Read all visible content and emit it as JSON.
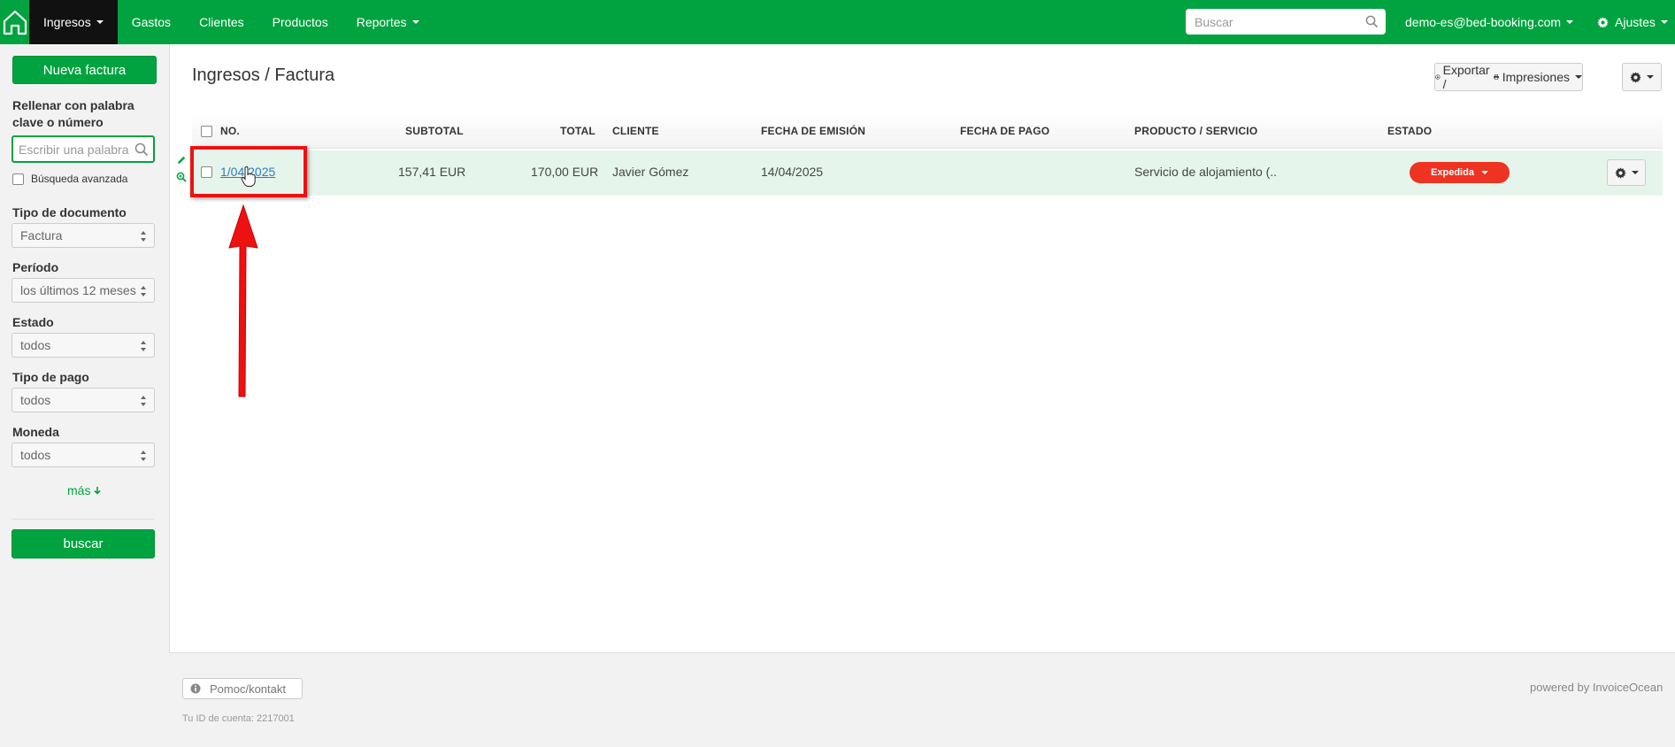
{
  "nav": {
    "items": [
      {
        "label": "Ingresos",
        "active": true,
        "dropdown": true
      },
      {
        "label": "Gastos",
        "active": false,
        "dropdown": false
      },
      {
        "label": "Clientes",
        "active": false,
        "dropdown": false
      },
      {
        "label": "Productos",
        "active": false,
        "dropdown": false
      },
      {
        "label": "Reportes",
        "active": false,
        "dropdown": true
      }
    ],
    "search_placeholder": "Buscar",
    "user": "demo-es@bed-booking.com",
    "settings": "Ajustes",
    "brand_color": "#00a33f"
  },
  "sidebar": {
    "new_invoice": "Nueva factura",
    "keyword_label": "Rellenar con palabra clave o número",
    "keyword_placeholder": "Escribir una palabra o número",
    "advanced_search": "Búsqueda avanzada",
    "filters": [
      {
        "label": "Tipo de documento",
        "value": "Factura"
      },
      {
        "label": "Período",
        "value": "los últimos 12 meses"
      },
      {
        "label": "Estado",
        "value": "todos"
      },
      {
        "label": "Tipo de pago",
        "value": "todos"
      },
      {
        "label": "Moneda",
        "value": "todos"
      }
    ],
    "more": "más",
    "search_button": "buscar"
  },
  "main": {
    "breadcrumb": "Ingresos / Factura",
    "export": "Exportar /",
    "prints": "Impresiones",
    "columns": [
      "NO.",
      "SUBTOTAL",
      "TOTAL",
      "CLIENTE",
      "FECHA DE EMISIÓN",
      "FECHA DE PAGO",
      "PRODUCTO / SERVICIO",
      "ESTADO"
    ],
    "rows": [
      {
        "number": "1/04/2025",
        "subtotal": "157,41 EUR",
        "total": "170,00 EUR",
        "client": "Javier Gómez",
        "issue_date": "14/04/2025",
        "payment_date": "",
        "product": "Servicio de alojamiento (..",
        "status": "Expedida"
      }
    ],
    "status_color": "#ee3322"
  },
  "footer": {
    "help": "Pomoc/kontakt",
    "account_id": "Tu ID de cuenta: 2217001",
    "powered": "powered by InvoiceOcean"
  },
  "icons": [
    "home-icon",
    "search-icon",
    "gear-icon",
    "printer-icon",
    "download-icon",
    "pencil-icon",
    "zoom-icon",
    "info-icon",
    "arrow-down-icon",
    "hand-cursor-icon"
  ]
}
